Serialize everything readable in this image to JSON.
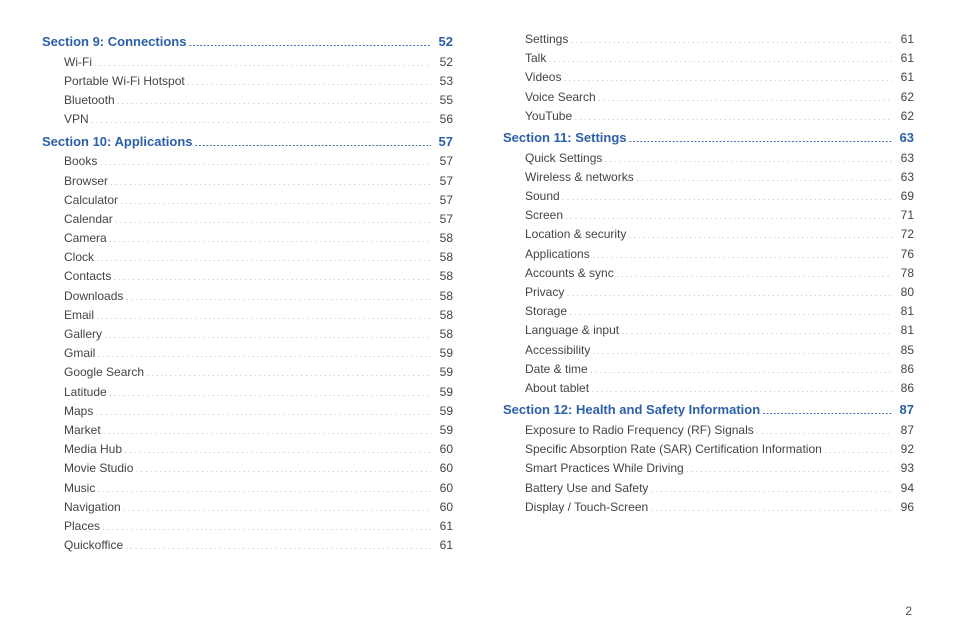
{
  "page_number": "2",
  "columns": [
    [
      {
        "type": "section",
        "title": "Section 9:  Connections",
        "page": "52"
      },
      {
        "type": "item",
        "title": "Wi-Fi",
        "page": "52"
      },
      {
        "type": "item",
        "title": "Portable Wi-Fi Hotspot",
        "page": "53"
      },
      {
        "type": "item",
        "title": "Bluetooth",
        "page": "55"
      },
      {
        "type": "item",
        "title": "VPN",
        "page": "56"
      },
      {
        "type": "section",
        "title": "Section 10:  Applications",
        "page": "57"
      },
      {
        "type": "item",
        "title": "Books",
        "page": "57"
      },
      {
        "type": "item",
        "title": "Browser",
        "page": "57"
      },
      {
        "type": "item",
        "title": "Calculator",
        "page": "57"
      },
      {
        "type": "item",
        "title": "Calendar",
        "page": "57"
      },
      {
        "type": "item",
        "title": "Camera",
        "page": "58"
      },
      {
        "type": "item",
        "title": "Clock",
        "page": "58"
      },
      {
        "type": "item",
        "title": "Contacts",
        "page": "58"
      },
      {
        "type": "item",
        "title": "Downloads",
        "page": "58"
      },
      {
        "type": "item",
        "title": "Email",
        "page": "58"
      },
      {
        "type": "item",
        "title": "Gallery",
        "page": "58"
      },
      {
        "type": "item",
        "title": "Gmail",
        "page": "59"
      },
      {
        "type": "item",
        "title": "Google Search",
        "page": "59"
      },
      {
        "type": "item",
        "title": "Latitude",
        "page": "59"
      },
      {
        "type": "item",
        "title": "Maps",
        "page": "59"
      },
      {
        "type": "item",
        "title": "Market",
        "page": "59"
      },
      {
        "type": "item",
        "title": "Media Hub",
        "page": "60"
      },
      {
        "type": "item",
        "title": "Movie Studio",
        "page": "60"
      },
      {
        "type": "item",
        "title": "Music",
        "page": "60"
      },
      {
        "type": "item",
        "title": "Navigation",
        "page": "60"
      },
      {
        "type": "item",
        "title": "Places",
        "page": "61"
      },
      {
        "type": "item",
        "title": "Quickoffice",
        "page": "61"
      }
    ],
    [
      {
        "type": "item",
        "title": "Settings",
        "page": "61"
      },
      {
        "type": "item",
        "title": "Talk",
        "page": "61"
      },
      {
        "type": "item",
        "title": "Videos",
        "page": "61"
      },
      {
        "type": "item",
        "title": "Voice Search",
        "page": "62"
      },
      {
        "type": "item",
        "title": "YouTube",
        "page": "62"
      },
      {
        "type": "section",
        "title": "Section 11:  Settings",
        "page": "63"
      },
      {
        "type": "item",
        "title": "Quick Settings",
        "page": "63"
      },
      {
        "type": "item",
        "title": "Wireless & networks",
        "page": "63"
      },
      {
        "type": "item",
        "title": "Sound",
        "page": "69"
      },
      {
        "type": "item",
        "title": "Screen",
        "page": "71"
      },
      {
        "type": "item",
        "title": "Location & security",
        "page": "72"
      },
      {
        "type": "item",
        "title": "Applications",
        "page": "76"
      },
      {
        "type": "item",
        "title": "Accounts & sync",
        "page": "78"
      },
      {
        "type": "item",
        "title": "Privacy",
        "page": "80"
      },
      {
        "type": "item",
        "title": "Storage",
        "page": "81"
      },
      {
        "type": "item",
        "title": "Language & input",
        "page": "81"
      },
      {
        "type": "item",
        "title": "Accessibility",
        "page": "85"
      },
      {
        "type": "item",
        "title": "Date & time",
        "page": "86"
      },
      {
        "type": "item",
        "title": "About tablet",
        "page": "86"
      },
      {
        "type": "section",
        "title": "Section 12:  Health and Safety Information",
        "page": "87"
      },
      {
        "type": "item",
        "title": "Exposure to Radio Frequency (RF) Signals",
        "page": "87"
      },
      {
        "type": "item",
        "title": "Specific Absorption Rate (SAR) Certification Information",
        "page": "92"
      },
      {
        "type": "item",
        "title": "Smart Practices While Driving",
        "page": "93"
      },
      {
        "type": "item",
        "title": "Battery Use and Safety",
        "page": "94"
      },
      {
        "type": "item",
        "title": "Display / Touch-Screen",
        "page": "96"
      }
    ]
  ]
}
